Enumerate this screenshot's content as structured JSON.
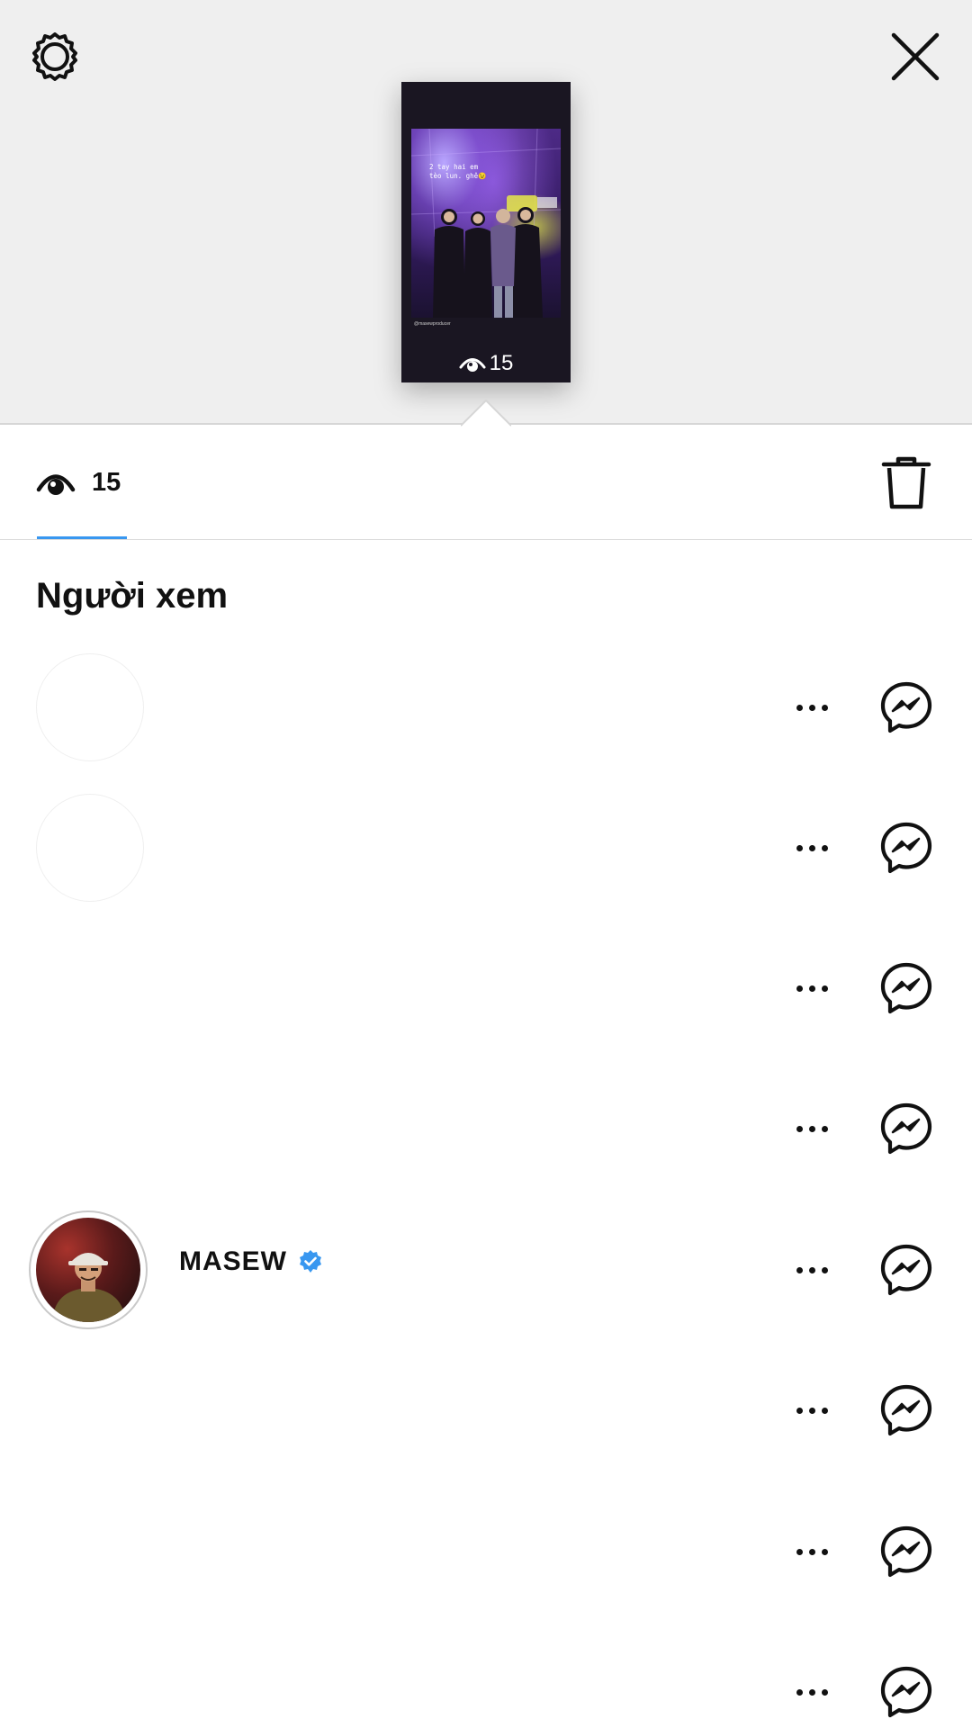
{
  "header": {
    "settings_icon": "gear-icon",
    "close_icon": "close-icon"
  },
  "story_preview": {
    "caption_line1": "2 tay hai em",
    "caption_line2": "tèo lun. ghê😉",
    "handle": "@masewproducer",
    "view_count": "15"
  },
  "stats": {
    "views_icon": "eye-icon",
    "view_count": "15",
    "delete_icon": "trash-icon",
    "accent_color": "#3897f0"
  },
  "viewers": {
    "title": "Người xem",
    "items": [
      {
        "username": "",
        "verified": false
      },
      {
        "username": "",
        "verified": false
      },
      {
        "username": "",
        "verified": false
      },
      {
        "username": "",
        "verified": false
      },
      {
        "username": "MASEW",
        "verified": true
      },
      {
        "username": "",
        "verified": false
      },
      {
        "username": "",
        "verified": false
      },
      {
        "username": "",
        "verified": false
      }
    ]
  },
  "colors": {
    "verified_badge": "#3897f0",
    "top_background": "#efefef"
  }
}
